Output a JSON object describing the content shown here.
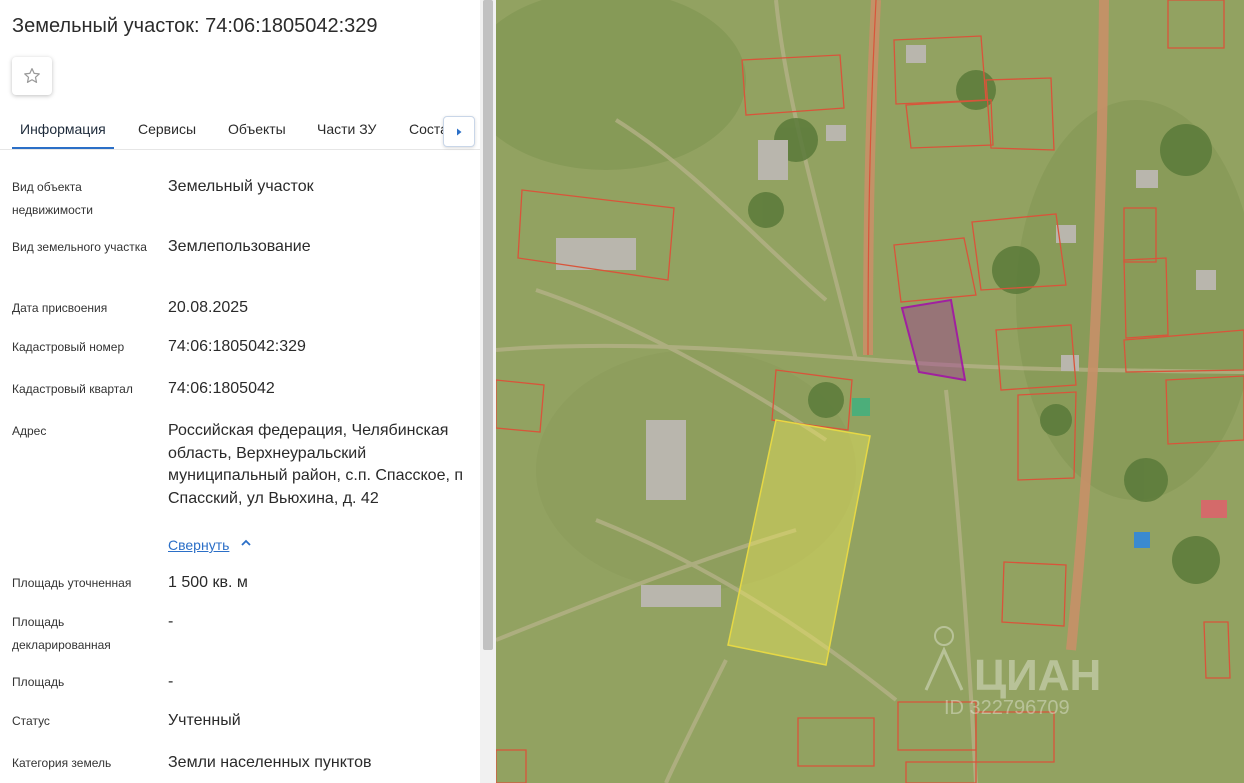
{
  "header": {
    "title": "Земельный участок: 74:06:1805042:329"
  },
  "tabs": [
    {
      "label": "Информация",
      "active": true
    },
    {
      "label": "Сервисы",
      "active": false
    },
    {
      "label": "Объекты",
      "active": false
    },
    {
      "label": "Части ЗУ",
      "active": false
    },
    {
      "label": "Состав",
      "active": false
    }
  ],
  "fields": {
    "object_type": {
      "label": "Вид объекта недвижимости",
      "value": "Земельный участок"
    },
    "land_type": {
      "label": "Вид земельного участка",
      "value": "Землепользование"
    },
    "assigned_date": {
      "label": "Дата присвоения",
      "value": "20.08.2025"
    },
    "cadastral_number": {
      "label": "Кадастровый номер",
      "value": "74:06:1805042:329"
    },
    "cadastral_quarter": {
      "label": "Кадастровый квартал",
      "value": "74:06:1805042"
    },
    "address": {
      "label": "Адрес",
      "value": "Российская федерация, Челябинская область, Верхнеуральский муниципальный район, с.п. Спасское, п Спасский, ул Вьюхина, д. 42",
      "collapse_label": "Свернуть"
    },
    "area_specified": {
      "label": "Площадь уточненная",
      "value": "1 500 кв. м"
    },
    "area_declared": {
      "label": "Площадь декларированная",
      "value": "-"
    },
    "area": {
      "label": "Площадь",
      "value": "-"
    },
    "status": {
      "label": "Статус",
      "value": "Учтенный"
    },
    "land_category": {
      "label": "Категория земель",
      "value": "Земли населенных пунктов"
    }
  },
  "map": {
    "watermark_brand": "ЦИАН",
    "watermark_id": "ID 322796709"
  },
  "colors": {
    "accent": "#2b6fc7",
    "parcel_outline": "#d9543a",
    "selected_parcel": "#a020a0",
    "highlight_parcel": "#f0ea5a",
    "road": "#c89068"
  }
}
